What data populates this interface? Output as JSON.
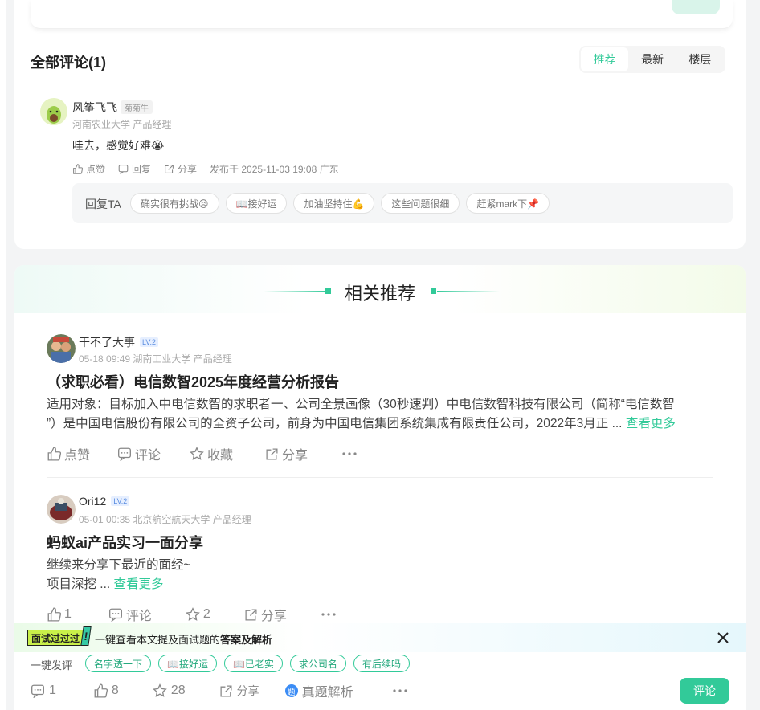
{
  "comments_section": {
    "title": "全部评论(1)",
    "sort_tabs": [
      "推荐",
      "最新",
      "楼层"
    ],
    "active_tab": "推荐"
  },
  "comment": {
    "author": "风筝飞飞",
    "badge": "菊菊牛",
    "subtitle": "河南农业大学 产品经理",
    "text": "哇去，感觉好难😭",
    "like": "点赞",
    "reply": "回复",
    "share": "分享",
    "published": "发布于 2025-11-03 19:08 广东",
    "reply_label": "回复TA",
    "reply_chips": [
      "确实很有挑战😣",
      "📖接好运",
      "加油坚持住💪",
      "这些问题很细",
      "赶紧mark下📌"
    ]
  },
  "related": {
    "title": "相关推荐",
    "posts": [
      {
        "author": "干不了大事",
        "level": "LV.2",
        "meta": "05-18 09:49  湖南工业大学 产品经理",
        "title": "（求职必看）电信数智2025年度经营分析报告",
        "body_line1": "适用对象：目标加入中电信数智的求职者一、公司全景画像（30秒速判）中电信数智科技有限公司（简称“电信数智",
        "body_line2": "”）是中国电信股份有限公司的全资子公司，前身为中国电信集团系统集成有限责任公司，2022年3月正 ...",
        "more": "查看更多",
        "like": "点赞",
        "comment": "评论",
        "fav": "收藏",
        "share": "分享"
      },
      {
        "author": "Ori12",
        "level": "LV.2",
        "meta": "05-01 00:35  北京航空航天大学 产品经理",
        "title": "蚂蚁ai产品实习一面分享",
        "body_line1": "继续来分享下最近的面经~",
        "body_line2": "项目深挖 ...",
        "more": "查看更多",
        "like": "1",
        "comment": "评论",
        "fav": "2",
        "share": "分享"
      }
    ]
  },
  "banner": {
    "tag": "面试过过过",
    "text_plain": "一键查看本文提及面试题的",
    "text_bold": "答案及解析"
  },
  "bottom": {
    "quick_label": "一键发评",
    "quick_chips": [
      "名字透一下",
      "📖接好运",
      "📖已老实",
      "求公司名",
      "有后续吗"
    ],
    "comments": "1",
    "likes": "8",
    "favs": "28",
    "share": "分享",
    "exam": "真题解析",
    "comment_button": "评论"
  },
  "colors": {
    "accent": "#32ca99",
    "level": "#5a8de0"
  }
}
